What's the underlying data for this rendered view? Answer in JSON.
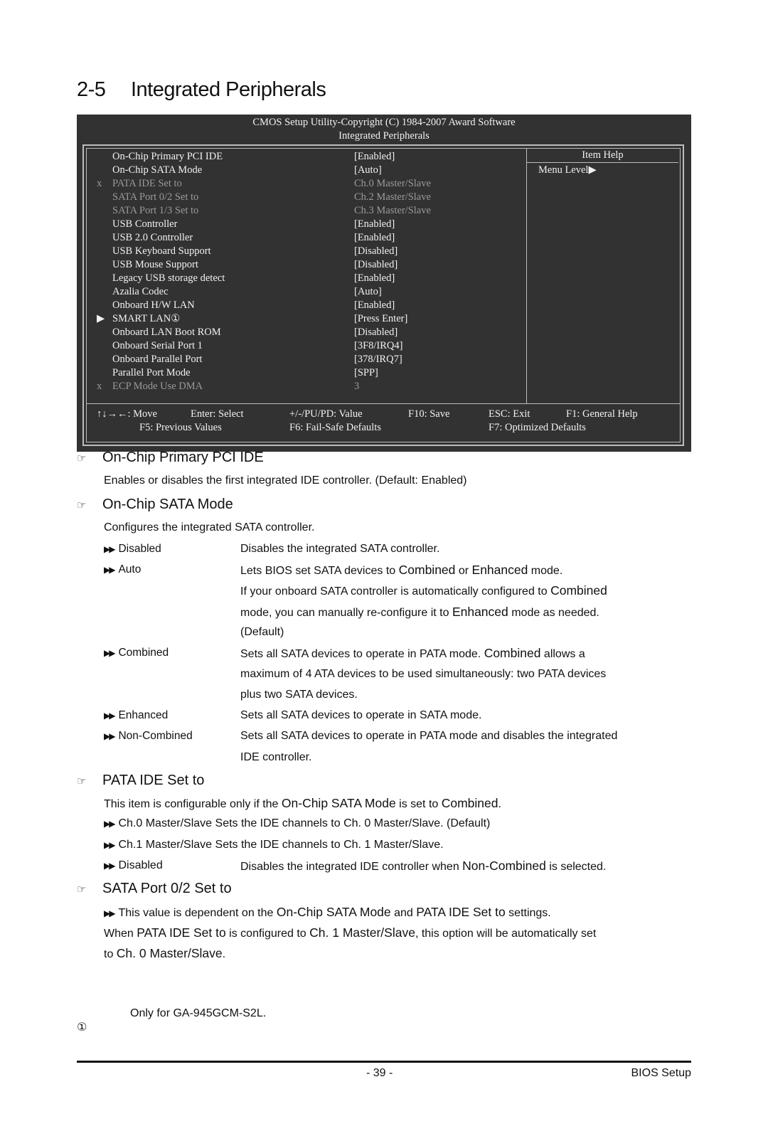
{
  "page": {
    "section_number": "2-5",
    "section_title": "Integrated Peripherals",
    "page_number": "- 39 -",
    "chapter": "BIOS Setup"
  },
  "bios": {
    "header_line1": "CMOS Setup Utility-Copyright (C) 1984-2007 Award Software",
    "header_line2": "Integrated Peripherals",
    "items": [
      {
        "mark": "",
        "name": "On-Chip Primary PCI IDE",
        "value": "[Enabled]",
        "disabled": false
      },
      {
        "mark": "",
        "name": "On-Chip SATA Mode",
        "value": "[Auto]",
        "disabled": false
      },
      {
        "mark": "x",
        "name": "PATA IDE Set to",
        "value": "Ch.0 Master/Slave",
        "disabled": true
      },
      {
        "mark": "",
        "name": "SATA Port 0/2 Set to",
        "value": "Ch.2 Master/Slave",
        "disabled": true
      },
      {
        "mark": "",
        "name": "SATA Port 1/3 Set to",
        "value": "Ch.3 Master/Slave",
        "disabled": true
      },
      {
        "mark": "",
        "name": "USB Controller",
        "value": "[Enabled]",
        "disabled": false
      },
      {
        "mark": "",
        "name": "USB 2.0 Controller",
        "value": "[Enabled]",
        "disabled": false
      },
      {
        "mark": "",
        "name": "USB Keyboard Support",
        "value": "[Disabled]",
        "disabled": false
      },
      {
        "mark": "",
        "name": "USB Mouse Support",
        "value": "[Disabled]",
        "disabled": false
      },
      {
        "mark": "",
        "name": "Legacy USB storage detect",
        "value": "[Enabled]",
        "disabled": false
      },
      {
        "mark": "",
        "name": "Azalia Codec",
        "value": "[Auto]",
        "disabled": false
      },
      {
        "mark": "",
        "name": "Onboard H/W LAN",
        "value": "[Enabled]",
        "disabled": false
      },
      {
        "mark": "▶",
        "name": "SMART LAN①",
        "value": "[Press Enter]",
        "disabled": false
      },
      {
        "mark": "",
        "name": "Onboard LAN Boot ROM",
        "value": "[Disabled]",
        "disabled": false
      },
      {
        "mark": "",
        "name": "Onboard Serial Port 1",
        "value": "[3F8/IRQ4]",
        "disabled": false
      },
      {
        "mark": "",
        "name": "Onboard Parallel Port",
        "value": "[378/IRQ7]",
        "disabled": false
      },
      {
        "mark": "",
        "name": "Parallel Port Mode",
        "value": "[SPP]",
        "disabled": false
      },
      {
        "mark": "x",
        "name": "ECP Mode Use DMA",
        "value": "3",
        "disabled": true
      }
    ],
    "help_title": "Item Help",
    "help_menu_level": "Menu Level▶",
    "keys_row1": [
      "↑↓→←: Move",
      "Enter: Select",
      "+/-/PU/PD: Value",
      "F10: Save",
      "ESC: Exit",
      "F1: General Help"
    ],
    "keys_row2": [
      "F5: Previous Values",
      "F6: Fail-Safe Defaults",
      "F7: Optimized Defaults"
    ]
  },
  "sections": {
    "pci_ide": {
      "title": "On-Chip Primary PCI IDE",
      "desc": "Enables or disables the first integrated IDE controller. (Default: Enabled)"
    },
    "sata_mode": {
      "title": "On-Chip SATA Mode",
      "desc": "Configures the integrated SATA controller.",
      "opt_disabled": "Disabled",
      "opt_disabled_desc": "Disables the integrated SATA controller.",
      "opt_auto": "Auto",
      "opt_auto_l1a": "Lets BIOS set SATA devices to ",
      "opt_auto_l1b": "Combined",
      "opt_auto_l1c": " or ",
      "opt_auto_l1d": "Enhanced",
      "opt_auto_l1e": " mode.",
      "opt_auto_l2a": "If your onboard SATA controller is automatically configured to ",
      "opt_auto_l2b": "Combined",
      "opt_auto_l3a": "mode, you can manually re-configure it to ",
      "opt_auto_l3b": "Enhanced",
      "opt_auto_l3c": " mode as needed.",
      "opt_auto_l4": "(Default)",
      "opt_combined": "Combined",
      "opt_combined_l1a": "Sets all SATA devices to operate in PATA mode. ",
      "opt_combined_l1b": "Combined",
      "opt_combined_l1c": " allows a",
      "opt_combined_l2": "maximum of 4 ATA devices to be used simultaneously: two PATA devices",
      "opt_combined_l3": "plus two SATA devices.",
      "opt_enhanced": "Enhanced",
      "opt_enhanced_desc": "Sets all SATA devices to operate in SATA mode.",
      "opt_noncombined": "Non-Combined",
      "opt_noncombined_l1": "Sets all SATA devices to operate in PATA mode and disables the integrated",
      "opt_noncombined_l2": "IDE controller."
    },
    "pata": {
      "title": "PATA IDE Set to",
      "desc_a": "This item is configurable only if the ",
      "desc_b": "On-Chip SATA Mode",
      "desc_c": " is set to ",
      "desc_d": "Combined",
      "desc_e": ".",
      "opt_ch0": "Ch.0 Master/Slave Sets the IDE channels to Ch. 0 Master/Slave. (Default)",
      "opt_ch1": "Ch.1 Master/Slave Sets the IDE channels to Ch. 1 Master/Slave.",
      "opt_disabled": "Disabled",
      "opt_disabled_a": "Disables the integrated IDE controller when ",
      "opt_disabled_b": "Non-Combined",
      "opt_disabled_c": " is selected."
    },
    "sata02": {
      "title": "SATA Port 0/2 Set to",
      "l1a": "This value is dependent on the ",
      "l1b": "On-Chip SATA Mode",
      "l1c": " and ",
      "l1d": "PATA IDE Set to",
      "l1e": " settings.",
      "l2a": "When ",
      "l2b": "PATA IDE Set to",
      "l2c": " is configured to ",
      "l2d": "Ch. 1 Master/Slave",
      "l2e": ", this option will be automatically set",
      "l3a": "to ",
      "l3b": "Ch. 0 Master/Slave",
      "l3c": "."
    }
  },
  "footnote": {
    "marker": "①",
    "text": "Only for GA-945GCM-S2L."
  },
  "icons": {
    "hand": "☞",
    "double_arrow": "▶▶"
  }
}
